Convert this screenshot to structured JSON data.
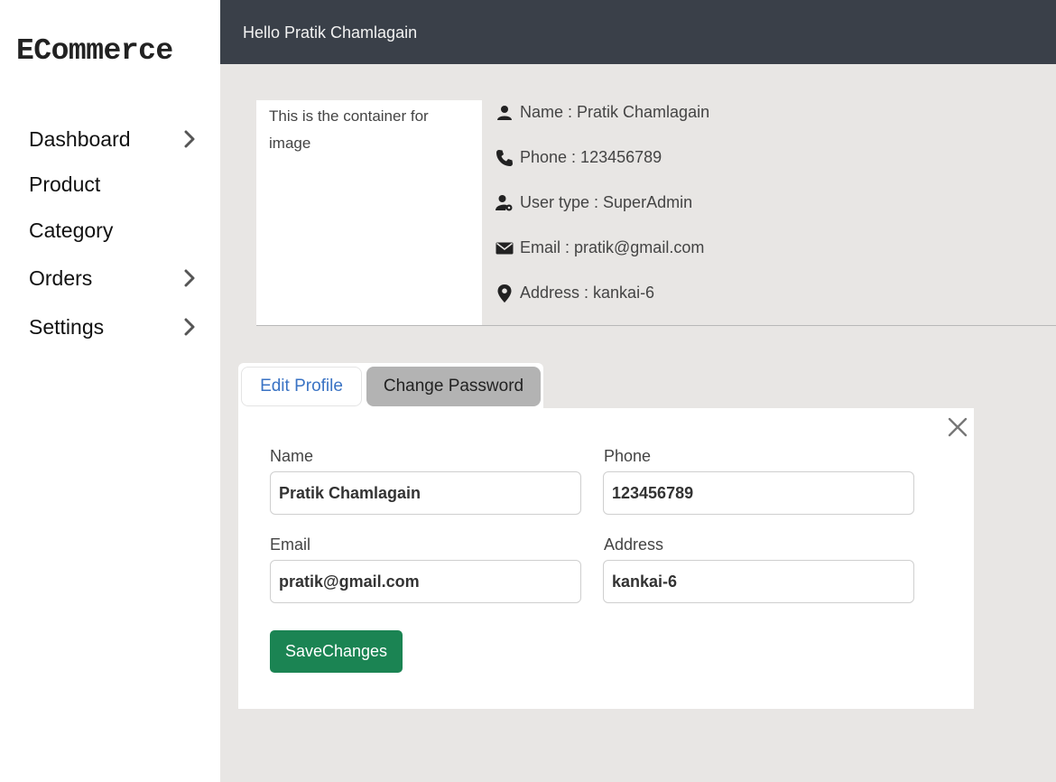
{
  "brand": "ECommerce",
  "header": {
    "greeting": "Hello Pratik Chamlagain"
  },
  "sidebar": {
    "items": [
      {
        "label": "Dashboard",
        "has_chevron": true
      },
      {
        "label": "Product",
        "has_chevron": false
      },
      {
        "label": "Category",
        "has_chevron": false
      },
      {
        "label": "Orders",
        "has_chevron": true
      },
      {
        "label": "Settings",
        "has_chevron": true
      }
    ]
  },
  "profile": {
    "image_placeholder": "This is the container for image",
    "info": [
      {
        "icon": "user-icon",
        "text": "Name : Pratik Chamlagain"
      },
      {
        "icon": "phone-icon",
        "text": "Phone : 123456789"
      },
      {
        "icon": "user-gear-icon",
        "text": "User type : SuperAdmin"
      },
      {
        "icon": "envelope-icon",
        "text": "Email : pratik@gmail.com"
      },
      {
        "icon": "location-pin-icon",
        "text": "Address : kankai-6"
      }
    ]
  },
  "tabs": [
    {
      "label": "Edit Profile",
      "active": true
    },
    {
      "label": "Change Password",
      "active": false
    }
  ],
  "form": {
    "name": {
      "label": "Name",
      "value": "Pratik Chamlagain"
    },
    "phone": {
      "label": "Phone",
      "value": "123456789"
    },
    "email": {
      "label": "Email",
      "value": "pratik@gmail.com"
    },
    "address": {
      "label": "Address",
      "value": "kankai-6"
    },
    "save_label": "SaveChanges"
  },
  "colors": {
    "topbar": "#3a4049",
    "content_bg": "#e8e6e4",
    "save_button": "#1b8453",
    "active_tab_text": "#3a73c4",
    "inactive_tab_bg": "#b3b3b3"
  }
}
